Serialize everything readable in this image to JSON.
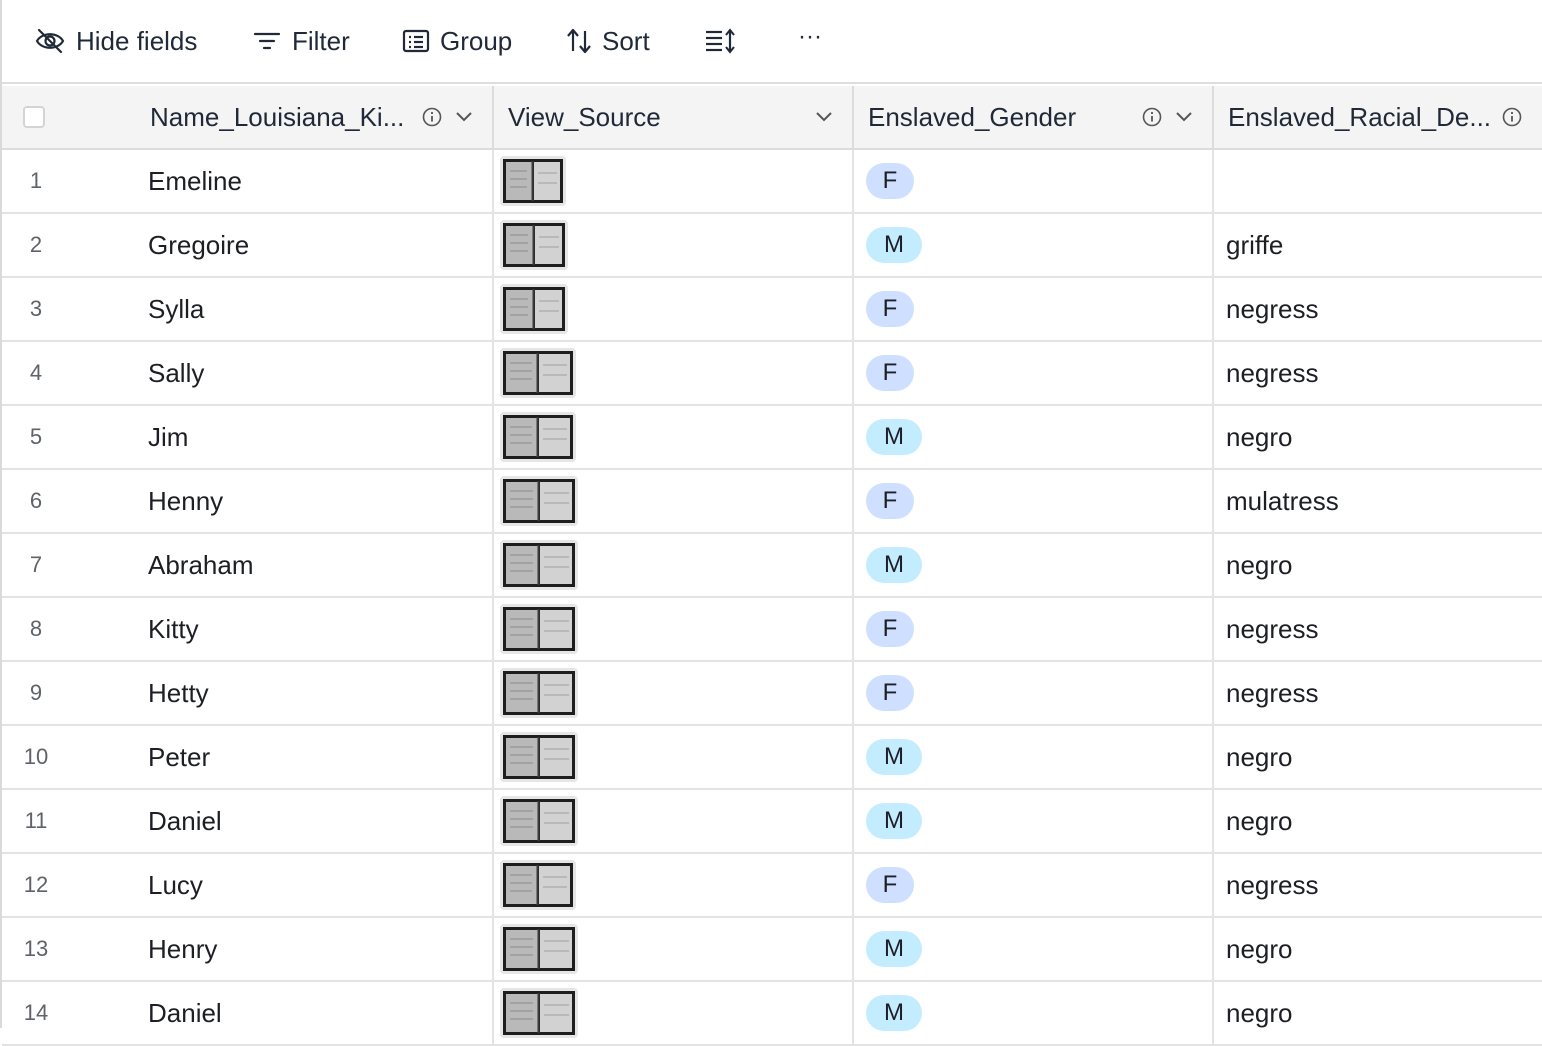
{
  "toolbar": {
    "hide_fields": "Hide fields",
    "filter": "Filter",
    "group": "Group",
    "sort": "Sort",
    "row_height_icon": "row-height-icon",
    "more": "···"
  },
  "columns": [
    {
      "label": "Name_Louisiana_Ki...",
      "info": true,
      "dropdown": true
    },
    {
      "label": "View_Source",
      "info": false,
      "dropdown": true
    },
    {
      "label": "Enslaved_Gender",
      "info": true,
      "dropdown": true
    },
    {
      "label": "Enslaved_Racial_De...",
      "info": true,
      "dropdown": false
    }
  ],
  "gender_colors": {
    "F": "#cfdfff",
    "M": "#c4ecff"
  },
  "rows": [
    {
      "num": "1",
      "name": "Emeline",
      "gender": "F",
      "racial": ""
    },
    {
      "num": "2",
      "name": "Gregoire",
      "gender": "M",
      "racial": "griffe"
    },
    {
      "num": "3",
      "name": "Sylla",
      "gender": "F",
      "racial": "negress"
    },
    {
      "num": "4",
      "name": "Sally",
      "gender": "F",
      "racial": "negress"
    },
    {
      "num": "5",
      "name": "Jim",
      "gender": "M",
      "racial": "negro"
    },
    {
      "num": "6",
      "name": "Henny",
      "gender": "F",
      "racial": "mulatress"
    },
    {
      "num": "7",
      "name": "Abraham",
      "gender": "M",
      "racial": "negro"
    },
    {
      "num": "8",
      "name": "Kitty",
      "gender": "F",
      "racial": "negress"
    },
    {
      "num": "9",
      "name": "Hetty",
      "gender": "F",
      "racial": "negress"
    },
    {
      "num": "10",
      "name": "Peter",
      "gender": "M",
      "racial": "negro"
    },
    {
      "num": "11",
      "name": "Daniel",
      "gender": "M",
      "racial": "negro"
    },
    {
      "num": "12",
      "name": "Lucy",
      "gender": "F",
      "racial": "negress"
    },
    {
      "num": "13",
      "name": "Henry",
      "gender": "M",
      "racial": "negro"
    },
    {
      "num": "14",
      "name": "Daniel",
      "gender": "M",
      "racial": "negro"
    }
  ]
}
